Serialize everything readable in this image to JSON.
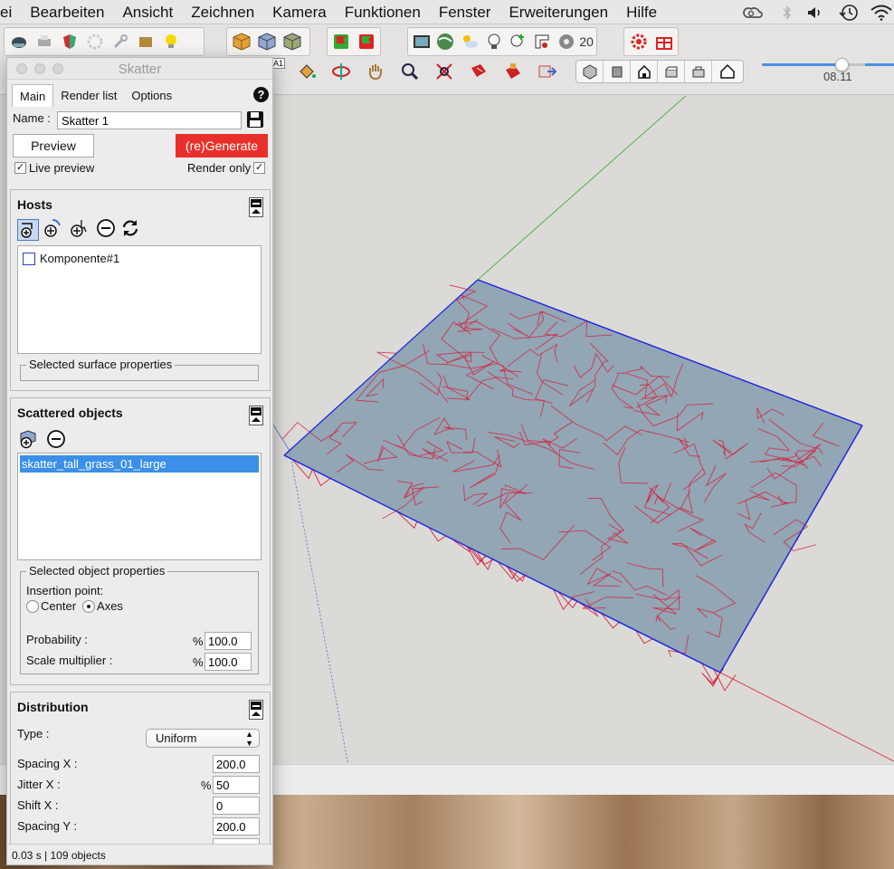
{
  "menubar": {
    "items": [
      "ei",
      "Bearbeiten",
      "Ansicht",
      "Zeichnen",
      "Kamera",
      "Funktionen",
      "Fenster",
      "Erweiterungen",
      "Hilfe"
    ]
  },
  "toolbar": {
    "hidden_text": "20",
    "slider_value": "08.11",
    "slider_fraction": 0.67,
    "colors": {
      "accent": "#4a90e2"
    }
  },
  "panel": {
    "title": "Skatter",
    "tabs": [
      "Main",
      "Render list",
      "Options"
    ],
    "help_label": "?",
    "name_label": "Name :",
    "name_value": "Skatter 1",
    "preview_label": "Preview",
    "generate_label": "(re)Generate",
    "generate_color": "#e8302a",
    "live_preview_label": "Live preview",
    "render_only_label": "Render only",
    "hosts": {
      "title": "Hosts",
      "items": [
        "Komponente#1"
      ],
      "surface_props_label": "Selected surface properties"
    },
    "scattered": {
      "title": "Scattered objects",
      "items": [
        "skatter_tall_grass_01_large"
      ],
      "selected_color": "#3b8fe8",
      "props_label": "Selected object properties",
      "insertion_label": "Insertion point:",
      "center_label": "Center",
      "axes_label": "Axes",
      "probability_label": "Probability :",
      "probability_value": "100.0",
      "scale_label": "Scale multiplier :",
      "scale_value": "100.0",
      "percent": "%"
    },
    "distribution": {
      "title": "Distribution",
      "type_label": "Type :",
      "type_value": "Uniform",
      "spacing_x_label": "Spacing X :",
      "spacing_x_value": "200.0",
      "jitter_x_label": "Jitter X :",
      "jitter_x_value": "50",
      "shift_x_label": "Shift X :",
      "shift_x_value": "0",
      "spacing_y_label": "Spacing Y :",
      "spacing_y_value": "200.0",
      "percent": "%"
    },
    "status": "0.03 s | 109 objects"
  }
}
